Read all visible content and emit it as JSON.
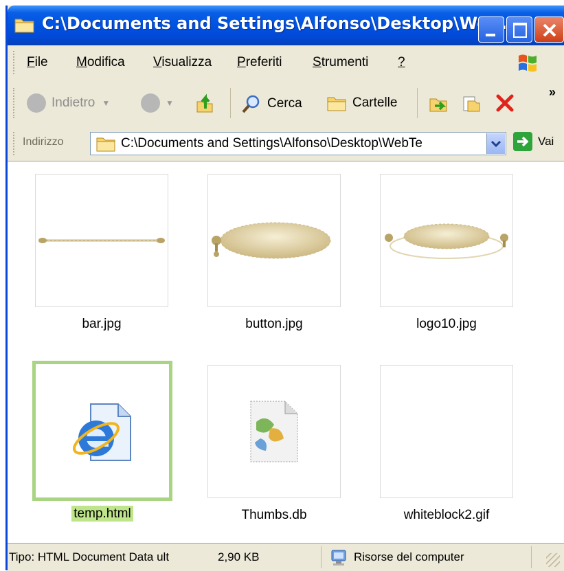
{
  "window": {
    "title": "C:\\Documents and Settings\\Alfonso\\Desktop\\We..."
  },
  "menu": {
    "items": [
      {
        "label": "File",
        "accel": "F",
        "rest": "ile"
      },
      {
        "label": "Modifica",
        "accel": "M",
        "rest": "odifica"
      },
      {
        "label": "Visualizza",
        "accel": "V",
        "rest": "isualizza"
      },
      {
        "label": "Preferiti",
        "accel": "P",
        "rest": "referiti"
      },
      {
        "label": "Strumenti",
        "accel": "S",
        "rest": "trumenti"
      },
      {
        "label": "?",
        "accel": "?",
        "rest": ""
      }
    ]
  },
  "toolbar": {
    "back_label": "Indietro",
    "search_label": "Cerca",
    "folders_label": "Cartelle",
    "more": "»"
  },
  "address": {
    "label": "Indirizzo",
    "label_accel": "d",
    "value": "C:\\Documents and Settings\\Alfonso\\Desktop\\WebTe",
    "go_label": "Vai"
  },
  "files": [
    {
      "name": "bar.jpg",
      "kind": "bar",
      "selected": false
    },
    {
      "name": "button.jpg",
      "kind": "button",
      "selected": false
    },
    {
      "name": "logo10.jpg",
      "kind": "logo",
      "selected": false
    },
    {
      "name": "temp.html",
      "kind": "ie-doc",
      "selected": true
    },
    {
      "name": "Thumbs.db",
      "kind": "db",
      "selected": false
    },
    {
      "name": "whiteblock2.gif",
      "kind": "blank",
      "selected": false
    }
  ],
  "status": {
    "type_text": "Tipo: HTML Document Data ult",
    "size_text": "2,90 KB",
    "zone_text": "Risorse del computer"
  },
  "colors": {
    "titlebar": "#0054e3",
    "selection_border": "#a9d484",
    "selection_label": "#bfe58a",
    "close_button": "#cf3f18"
  }
}
